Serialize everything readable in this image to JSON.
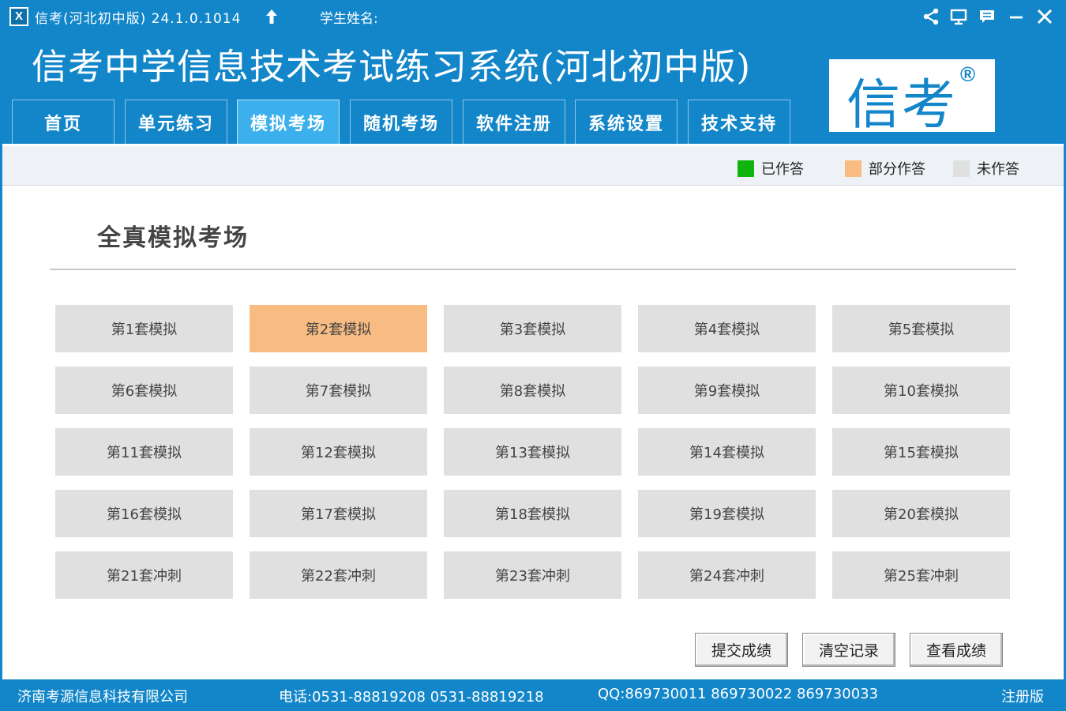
{
  "titlebar": {
    "logo_letter": "X",
    "app_title": "信考(河北初中版) 24.1.0.1014",
    "student_label": "学生姓名:"
  },
  "header": {
    "main_title": "信考中学信息技术考试练习系统(河北初中版)",
    "brand_text": "信考",
    "brand_reg": "®"
  },
  "tabs": [
    {
      "label": "首页",
      "active": false
    },
    {
      "label": "单元练习",
      "active": false
    },
    {
      "label": "模拟考场",
      "active": true
    },
    {
      "label": "随机考场",
      "active": false
    },
    {
      "label": "软件注册",
      "active": false
    },
    {
      "label": "系统设置",
      "active": false
    },
    {
      "label": "技术支持",
      "active": false
    }
  ],
  "legend": [
    {
      "label": "已作答",
      "color": "#0fb40f"
    },
    {
      "label": "部分作答",
      "color": "#f8bb82"
    },
    {
      "label": "未作答",
      "color": "#e0e0e0"
    }
  ],
  "section_title": "全真模拟考场",
  "sets": [
    {
      "label": "第1套模拟",
      "status": "unanswered"
    },
    {
      "label": "第2套模拟",
      "status": "partial"
    },
    {
      "label": "第3套模拟",
      "status": "unanswered"
    },
    {
      "label": "第4套模拟",
      "status": "unanswered"
    },
    {
      "label": "第5套模拟",
      "status": "unanswered"
    },
    {
      "label": "第6套模拟",
      "status": "unanswered"
    },
    {
      "label": "第7套模拟",
      "status": "unanswered"
    },
    {
      "label": "第8套模拟",
      "status": "unanswered"
    },
    {
      "label": "第9套模拟",
      "status": "unanswered"
    },
    {
      "label": "第10套模拟",
      "status": "unanswered"
    },
    {
      "label": "第11套模拟",
      "status": "unanswered"
    },
    {
      "label": "第12套模拟",
      "status": "unanswered"
    },
    {
      "label": "第13套模拟",
      "status": "unanswered"
    },
    {
      "label": "第14套模拟",
      "status": "unanswered"
    },
    {
      "label": "第15套模拟",
      "status": "unanswered"
    },
    {
      "label": "第16套模拟",
      "status": "unanswered"
    },
    {
      "label": "第17套模拟",
      "status": "unanswered"
    },
    {
      "label": "第18套模拟",
      "status": "unanswered"
    },
    {
      "label": "第19套模拟",
      "status": "unanswered"
    },
    {
      "label": "第20套模拟",
      "status": "unanswered"
    },
    {
      "label": "第21套冲刺",
      "status": "unanswered"
    },
    {
      "label": "第22套冲刺",
      "status": "unanswered"
    },
    {
      "label": "第23套冲刺",
      "status": "unanswered"
    },
    {
      "label": "第24套冲刺",
      "status": "unanswered"
    },
    {
      "label": "第25套冲刺",
      "status": "unanswered"
    }
  ],
  "actions": {
    "submit": "提交成绩",
    "clear": "清空记录",
    "view": "查看成绩"
  },
  "footer": {
    "company": "济南考源信息科技有限公司",
    "phone": "电话:0531-88819208  0531-88819218",
    "qq": "QQ:869730011  869730022  869730033",
    "edition": "注册版"
  },
  "colors": {
    "brand_blue": "#1286c9",
    "active_tab": "#3bb0ec",
    "partial": "#f8bb82",
    "unanswered": "#e0e0e0",
    "answered": "#0fb40f"
  }
}
